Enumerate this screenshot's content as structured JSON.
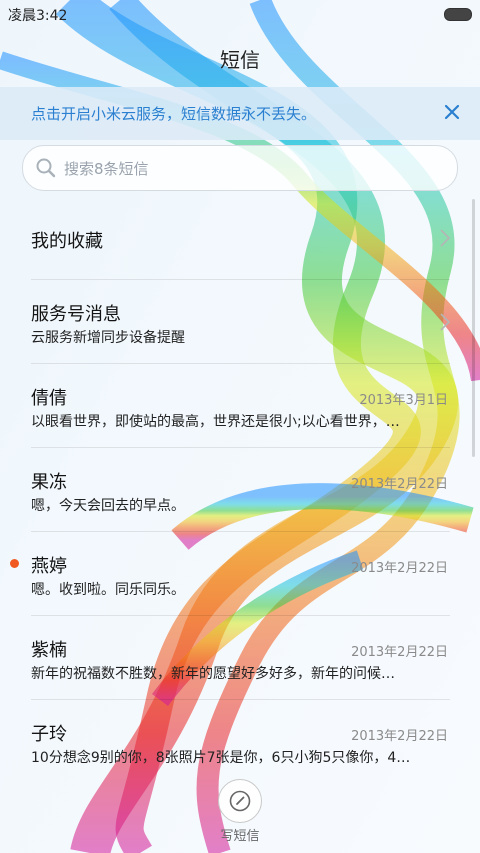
{
  "status_bar": {
    "time": "凌晨3:42"
  },
  "header": {
    "title": "短信"
  },
  "banner": {
    "text": "点击开启小米云服务，短信数据永不丢失。"
  },
  "search": {
    "placeholder": "搜索8条短信"
  },
  "threads": [
    {
      "name": "我的收藏"
    },
    {
      "name": "服务号消息",
      "preview": "云服务新增同步设备提醒"
    },
    {
      "name": "倩倩",
      "date": "2013年3月1日",
      "preview": "以眼看世界，即使站的最高，世界还是很小;以心看世界，…"
    },
    {
      "name": "果冻",
      "date": "2013年2月22日",
      "preview": "嗯，今天会回去的早点。"
    },
    {
      "name": "燕婷",
      "date": "2013年2月22日",
      "preview": "嗯。收到啦。同乐同乐。",
      "unread": true
    },
    {
      "name": "紫楠",
      "date": "2013年2月22日",
      "preview": "新年的祝福数不胜数，新年的愿望好多好多，新年的问候…"
    },
    {
      "name": "子玲",
      "date": "2013年2月22日",
      "preview": "10分想念9别的你，8张照片7张是你，6只小狗5只像你，4…"
    }
  ],
  "compose": {
    "label": "写短信"
  },
  "colors": {
    "accent": "#2a7fd0",
    "unread_dot": "#f05a22"
  }
}
